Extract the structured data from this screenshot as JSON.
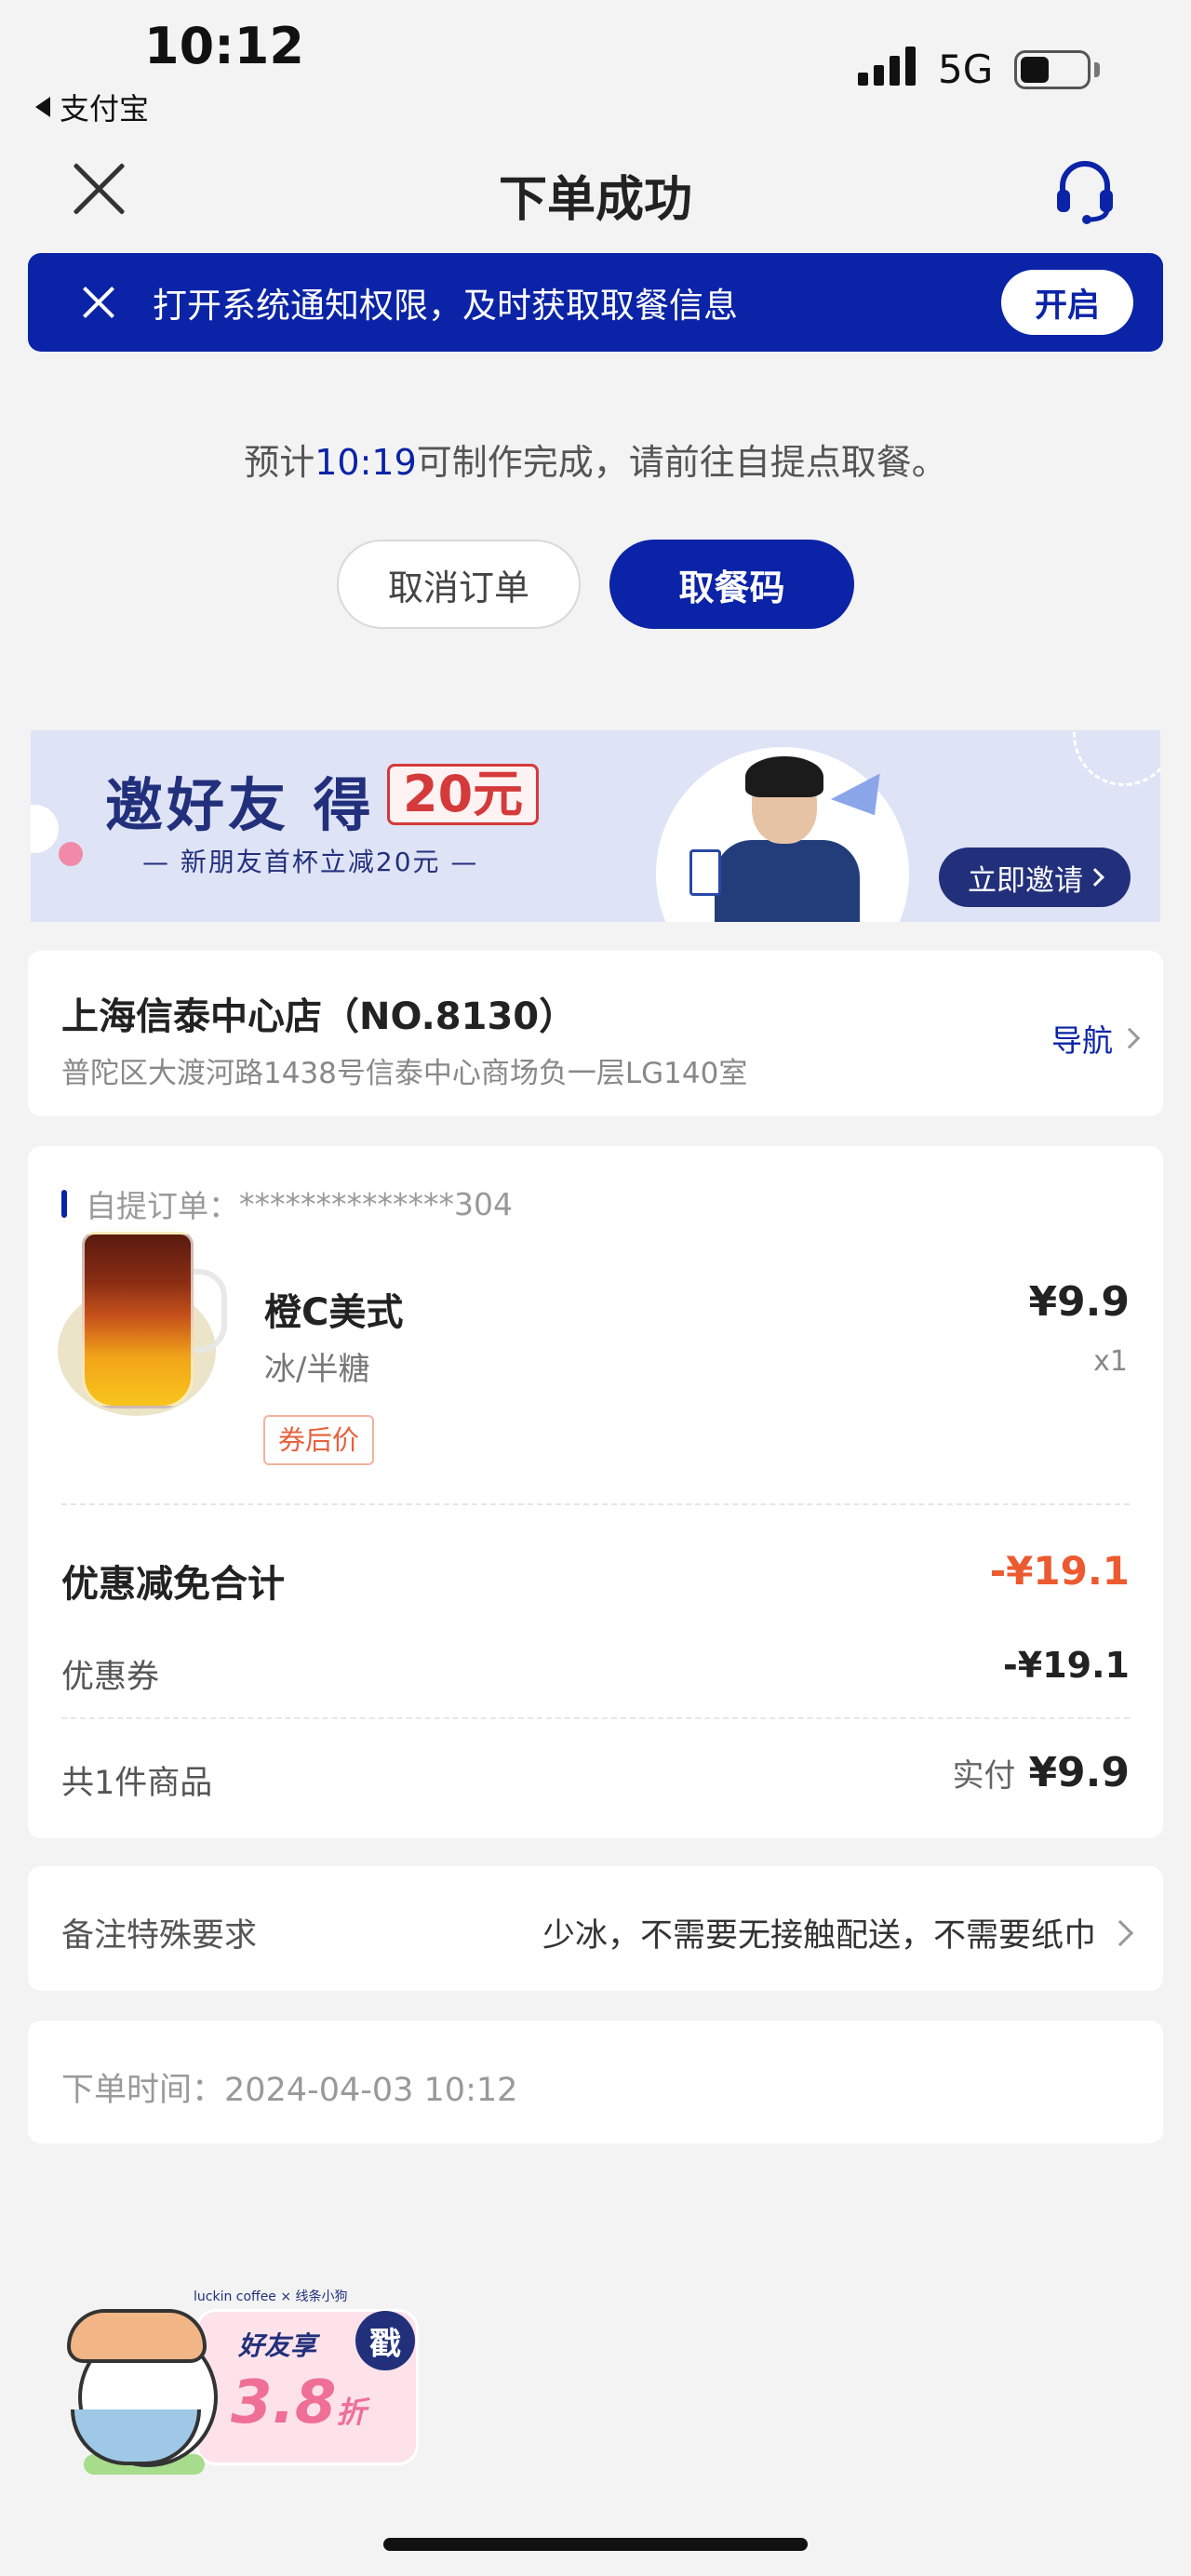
{
  "status_bar": {
    "time": "10:12",
    "back_app": "支付宝",
    "network": "5G",
    "battery_level": 0.44
  },
  "nav": {
    "title": "下单成功",
    "close_icon": "close-icon",
    "service_icon": "headset-icon"
  },
  "notice": {
    "text": "打开系统通知权限，及时获取取餐信息",
    "button": "开启"
  },
  "eta": {
    "prefix": "预计",
    "time": "10:19",
    "suffix": "可制作完成，请前往自提点取餐。"
  },
  "actions": {
    "cancel": "取消订单",
    "pickup_code": "取餐码"
  },
  "invite_banner": {
    "title": "邀好友 得",
    "amount": "20元",
    "subtitle": "— 新朋友首杯立减20元 —",
    "button": "立即邀请"
  },
  "store": {
    "name": "上海信泰中心店（NO.8130）",
    "address": "普陀区大渡河路1438号信泰中心商场负一层LG140室",
    "nav_label": "导航"
  },
  "order": {
    "header_label": "自提订单：",
    "order_no": "**************304",
    "item": {
      "name": "橙C美式",
      "spec": "冰/半糖",
      "badge": "券后价",
      "price": "¥9.9",
      "qty": "x1"
    },
    "discount_total_label": "优惠减免合计",
    "discount_total_value": "-¥19.1",
    "coupon_label": "优惠券",
    "coupon_value": "-¥19.1",
    "count_label": "共1件商品",
    "paid_label": "实付",
    "paid_value": "¥9.9"
  },
  "remark": {
    "label": "备注特殊要求",
    "value": "少冰，不需要无接触配送，不需要纸巾"
  },
  "order_time": {
    "text": "下单时间：2024-04-03 10:12"
  },
  "promo": {
    "brand": "luckin coffee × 线条小狗",
    "text": "好友享",
    "discount": "3.8",
    "unit": "折",
    "stamp": "戳"
  },
  "colors": {
    "brand_blue": "#0b23a6",
    "discount_red": "#ec5a30",
    "background": "#f3f3f3"
  }
}
